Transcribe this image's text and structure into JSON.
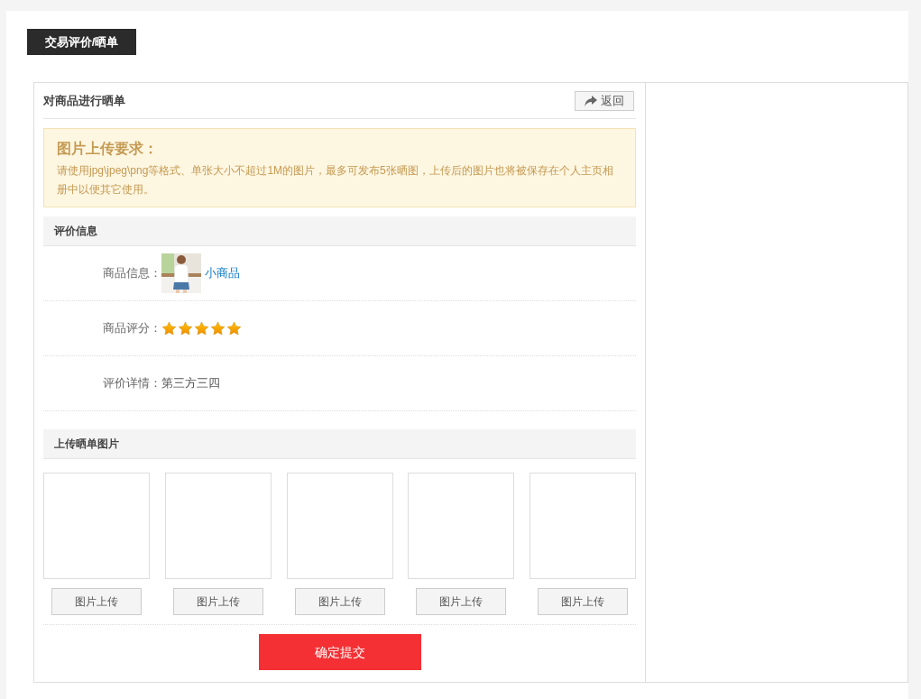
{
  "page_tab": "交易评价/晒单",
  "panel": {
    "title": "对商品进行晒单",
    "back_button": "返回"
  },
  "notice": {
    "title": "图片上传要求：",
    "text": "请使用jpg\\jpeg\\png等格式、单张大小不超过1M的图片，最多可发布5张晒图，上传后的图片也将被保存在个人主页相册中以便其它使用。"
  },
  "review_section": {
    "title": "评价信息",
    "rows": [
      {
        "kind": "product",
        "label": "商品信息：",
        "product_name": "小商品"
      },
      {
        "kind": "rating",
        "label": "商品评分：",
        "stars": 5
      },
      {
        "kind": "text",
        "label": "评价详情：",
        "value": "第三方三四"
      }
    ]
  },
  "upload_section": {
    "title": "上传晒单图片",
    "slots": [
      {
        "button": "图片上传"
      },
      {
        "button": "图片上传"
      },
      {
        "button": "图片上传"
      },
      {
        "button": "图片上传"
      },
      {
        "button": "图片上传"
      }
    ]
  },
  "submit_button": "确定提交"
}
